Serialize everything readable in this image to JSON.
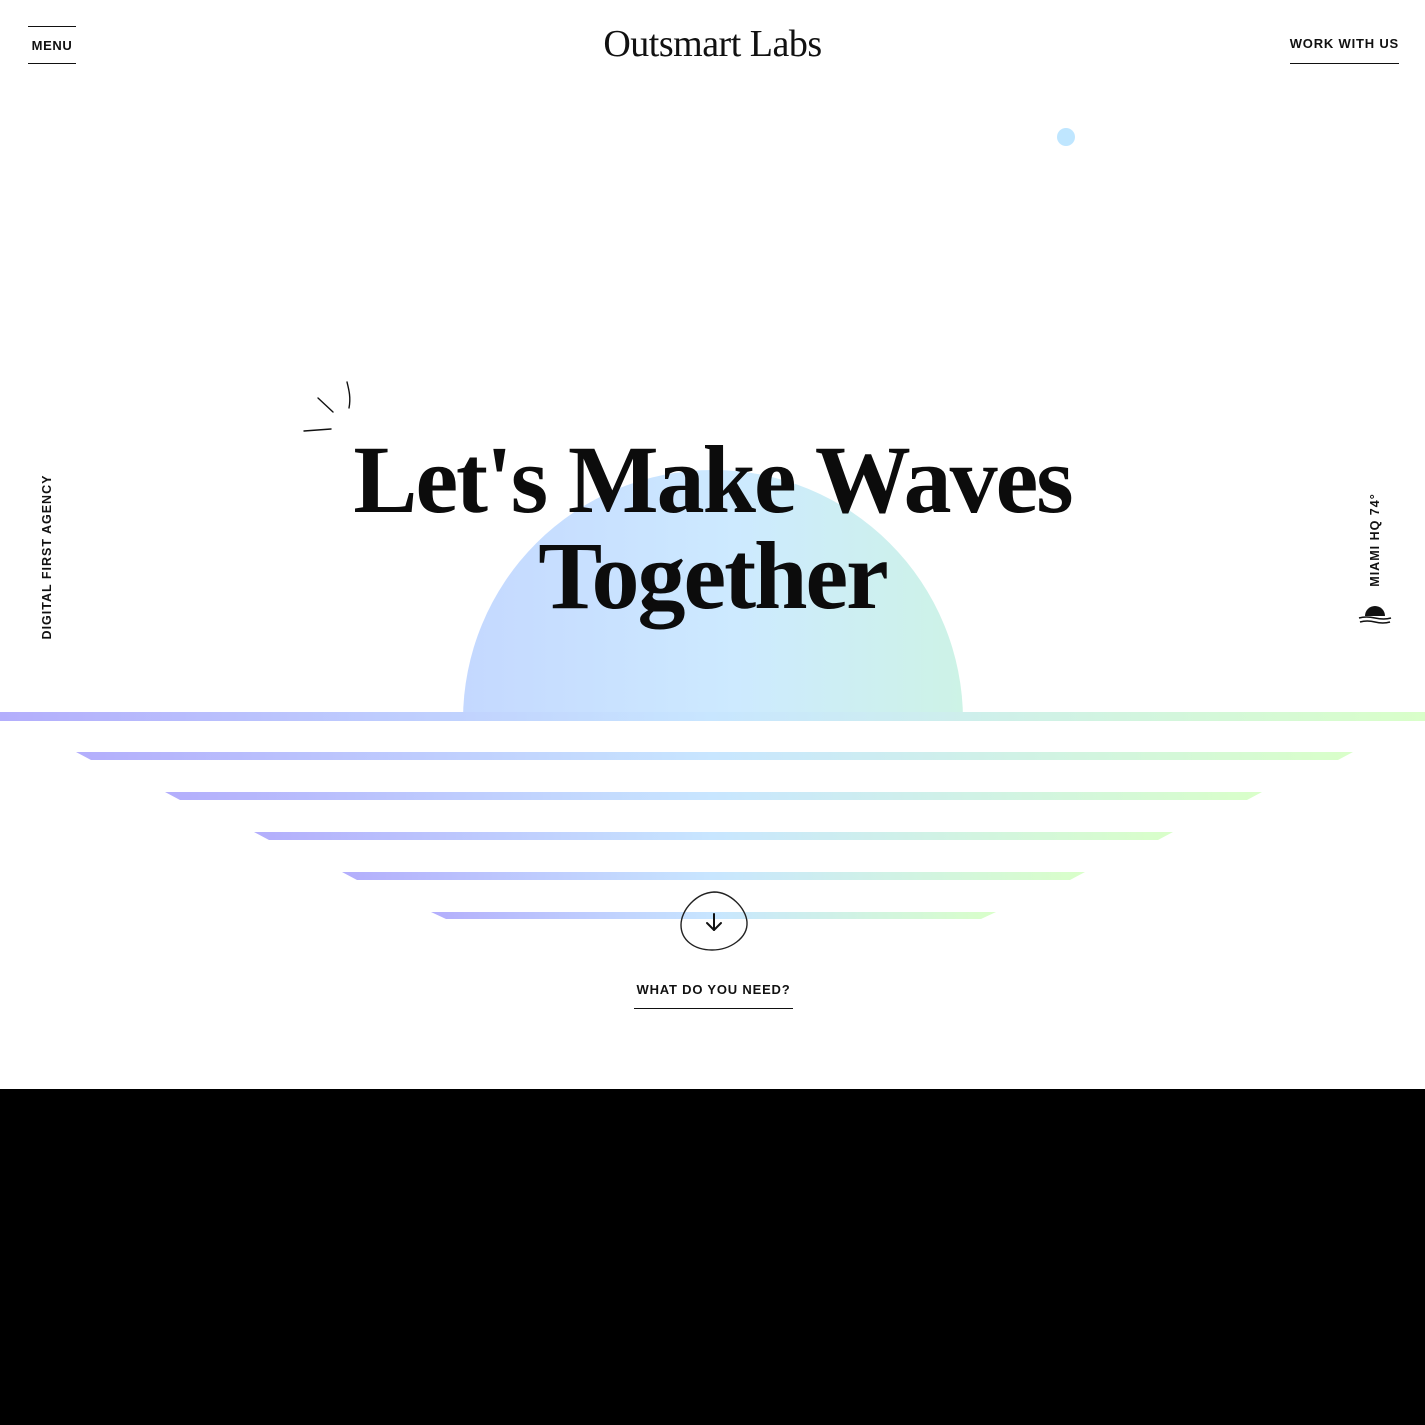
{
  "header": {
    "menu_label": "MENU",
    "logo_text": "Outsmart Labs",
    "cta_label": "WORK WITH US"
  },
  "hero": {
    "headline_line1": "Let's Make Waves",
    "headline_line2": "Together",
    "left_tagline": "DIGITAL FIRST AGENCY",
    "right_location": "MIAMI HQ 74°",
    "scroll_cta": "WHAT DO YOU NEED?"
  },
  "icons": {
    "scroll": "arrow-down-icon",
    "weather": "sunset-icon",
    "sparkle": "sparkle-icon"
  },
  "colors": {
    "background": "#ffffff",
    "text": "#111111",
    "gradient_start": "#b4b0ff",
    "gradient_mid": "#c7e8ff",
    "gradient_end": "#d7ffc7",
    "footer_panel": "#000000",
    "dot": "#bfe6ff"
  }
}
